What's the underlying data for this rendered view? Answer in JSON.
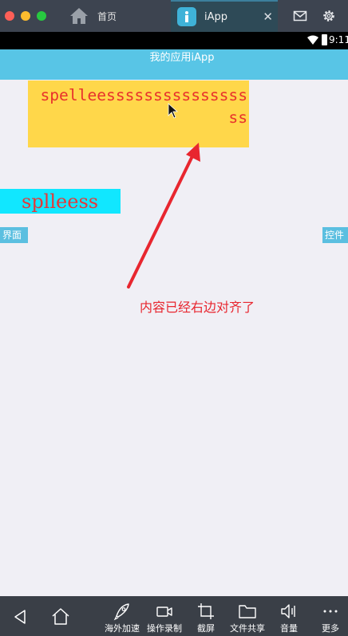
{
  "window": {
    "home_tab_label": "首页",
    "app_tab_label": "iApp",
    "close_glyph": "✕"
  },
  "status_bar": {
    "time": "9:11"
  },
  "app": {
    "title": "我的应用iApp",
    "yellow_box_text": "spelleesssssssssssssssss",
    "cyan_box_text": "splleess",
    "left_button_label": "界面",
    "right_button_label": "控件"
  },
  "annotation": {
    "text": "内容已经右边对齐了",
    "color": "#e8262f"
  },
  "bottom_toolbar": {
    "items": [
      {
        "label": "海外加速",
        "icon": "rocket-icon"
      },
      {
        "label": "操作录制",
        "icon": "video-camera-icon"
      },
      {
        "label": "截屏",
        "icon": "crop-icon"
      },
      {
        "label": "文件共享",
        "icon": "folder-icon"
      },
      {
        "label": "音量",
        "icon": "speaker-icon"
      },
      {
        "label": "更多",
        "icon": "more-dots-icon"
      }
    ]
  },
  "colors": {
    "app_header": "#58c5e6",
    "yellow_box": "#ffd74a",
    "cyan_box": "#11e7ff",
    "text_red": "#e8312c"
  }
}
